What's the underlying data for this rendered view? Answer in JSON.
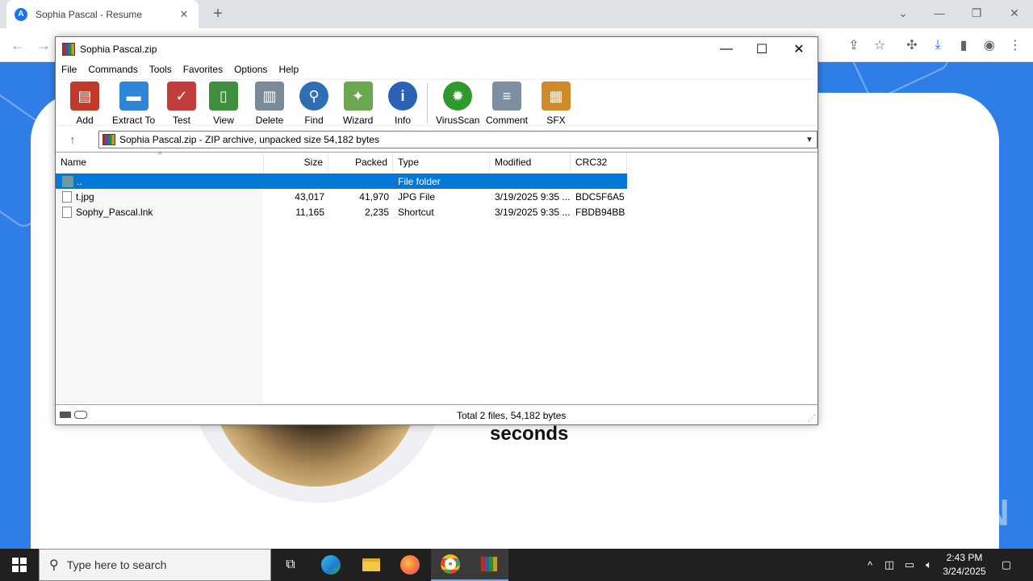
{
  "browser": {
    "tab_title": "Sophia Pascal - Resume",
    "tab_favicon_letter": "A",
    "new_tab_symbol": "+",
    "close_symbol": "✕"
  },
  "webpage": {
    "headline_fragment": "seconds",
    "watermark": "ANY RUN",
    "accent_color": "#2f7ee8"
  },
  "winrar": {
    "title": "Sophia Pascal.zip",
    "menu": [
      "File",
      "Commands",
      "Tools",
      "Favorites",
      "Options",
      "Help"
    ],
    "toolbar": [
      {
        "label": "Add",
        "icon": "add-archive-icon",
        "color": "#c0392b"
      },
      {
        "label": "Extract To",
        "icon": "extract-folder-icon",
        "color": "#2f86d8"
      },
      {
        "label": "Test",
        "icon": "test-clipboard-icon",
        "color": "#c43d3d"
      },
      {
        "label": "View",
        "icon": "view-book-icon",
        "color": "#3f8f3f"
      },
      {
        "label": "Delete",
        "icon": "delete-trash-icon",
        "color": "#7a8a99"
      },
      {
        "label": "Find",
        "icon": "find-magnifier-icon",
        "color": "#2f6db5"
      },
      {
        "label": "Wizard",
        "icon": "wizard-wand-icon",
        "color": "#6aa84f"
      },
      {
        "label": "Info",
        "icon": "info-icon",
        "color": "#2a62b8"
      },
      {
        "label": "VirusScan",
        "icon": "virusscan-icon",
        "color": "#2e9a2e"
      },
      {
        "label": "Comment",
        "icon": "comment-icon",
        "color": "#7d8ea3"
      },
      {
        "label": "SFX",
        "icon": "sfx-box-icon",
        "color": "#d08a2a"
      }
    ],
    "address": "Sophia Pascal.zip - ZIP archive, unpacked size 54,182 bytes",
    "columns": [
      "Name",
      "Size",
      "Packed",
      "Type",
      "Modified",
      "CRC32"
    ],
    "rows": [
      {
        "name": "..",
        "size": "",
        "packed": "",
        "type": "File folder",
        "modified": "",
        "crc": "",
        "selected": true
      },
      {
        "name": "t.jpg",
        "size": "43,017",
        "packed": "41,970",
        "type": "JPG File",
        "modified": "3/19/2025 9:35 ...",
        "crc": "BDC5F6A5",
        "selected": false
      },
      {
        "name": "Sophy_Pascal.lnk",
        "size": "11,165",
        "packed": "2,235",
        "type": "Shortcut",
        "modified": "3/19/2025 9:35 ...",
        "crc": "FBDB94BB",
        "selected": false
      }
    ],
    "status": "Total 2 files, 54,182 bytes"
  },
  "taskbar": {
    "search_placeholder": "Type here to search",
    "time": "2:43 PM",
    "date": "3/24/2025"
  }
}
